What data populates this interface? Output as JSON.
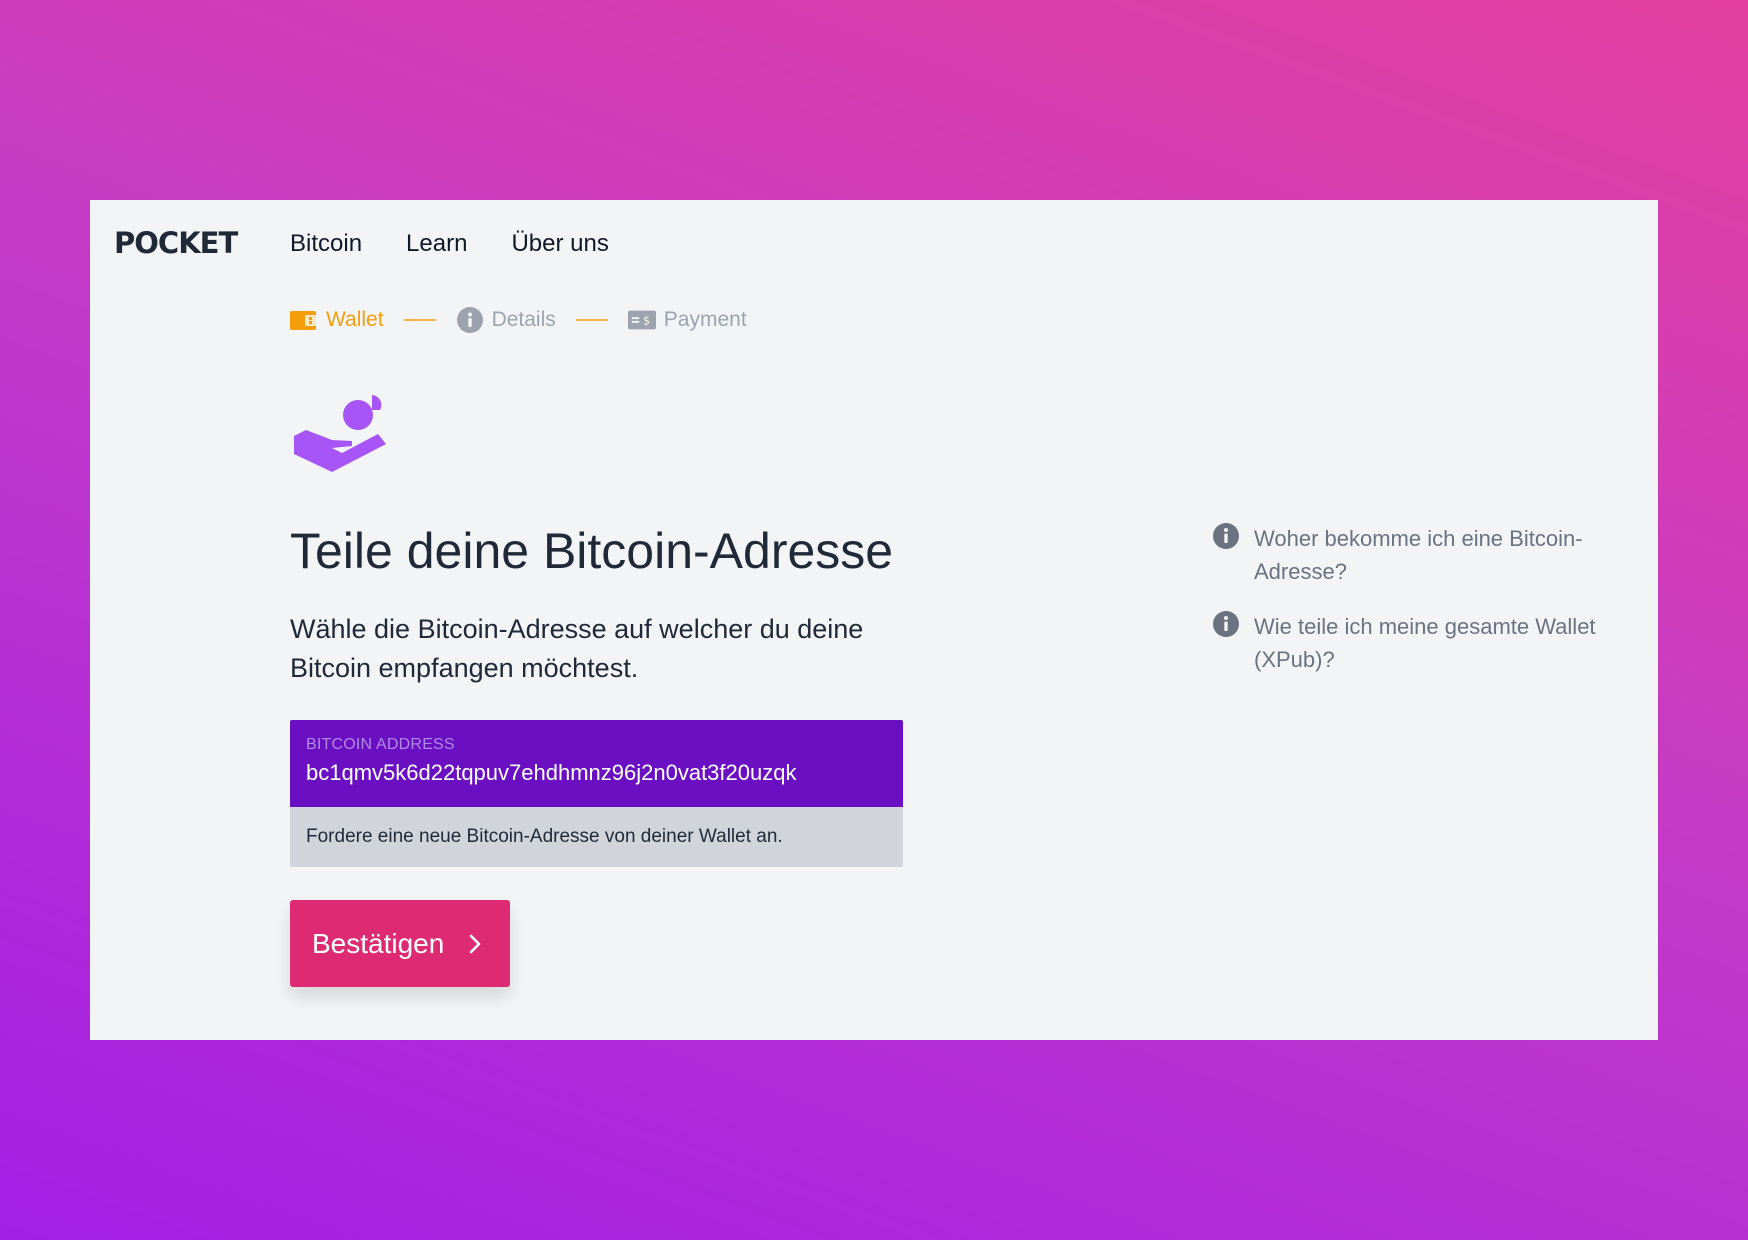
{
  "brand": {
    "logo": "POCKET"
  },
  "nav": {
    "items": [
      "Bitcoin",
      "Learn",
      "Über uns"
    ]
  },
  "stepper": {
    "steps": [
      {
        "label": "Wallet",
        "icon": "wallet-icon",
        "state": "active"
      },
      {
        "label": "Details",
        "icon": "info-circle-icon",
        "state": "inactive"
      },
      {
        "label": "Payment",
        "icon": "banknote-icon",
        "state": "inactive"
      }
    ]
  },
  "main": {
    "hero_icon": "hand-receiving-coin-icon",
    "title": "Teile deine Bitcoin-Adresse",
    "lead": "Wähle die Bitcoin-Adresse auf welcher du deine Bitcoin empfangen möchtest.",
    "address": {
      "label": "BITCOIN ADDRESS",
      "value": "bc1qmv5k6d22tqpuv7ehdhmnz96j2n0vat3f20uzqk",
      "hint": "Fordere eine neue Bitcoin-Adresse von deiner Wallet an."
    },
    "confirm_label": "Bestätigen"
  },
  "help": {
    "items": [
      {
        "icon": "info-circle-icon",
        "text": "Woher bekomme ich eine Bitcoin-Adresse?"
      },
      {
        "icon": "info-circle-icon",
        "text": "Wie teile ich meine gesamte Wallet (XPub)?"
      }
    ]
  },
  "colors": {
    "accent_orange": "#f59e0b",
    "address_bg": "#6b0fc2",
    "button_bg": "#dd2a73",
    "hero_purple": "#a855f7",
    "page_bg": "#f3f4f6"
  }
}
